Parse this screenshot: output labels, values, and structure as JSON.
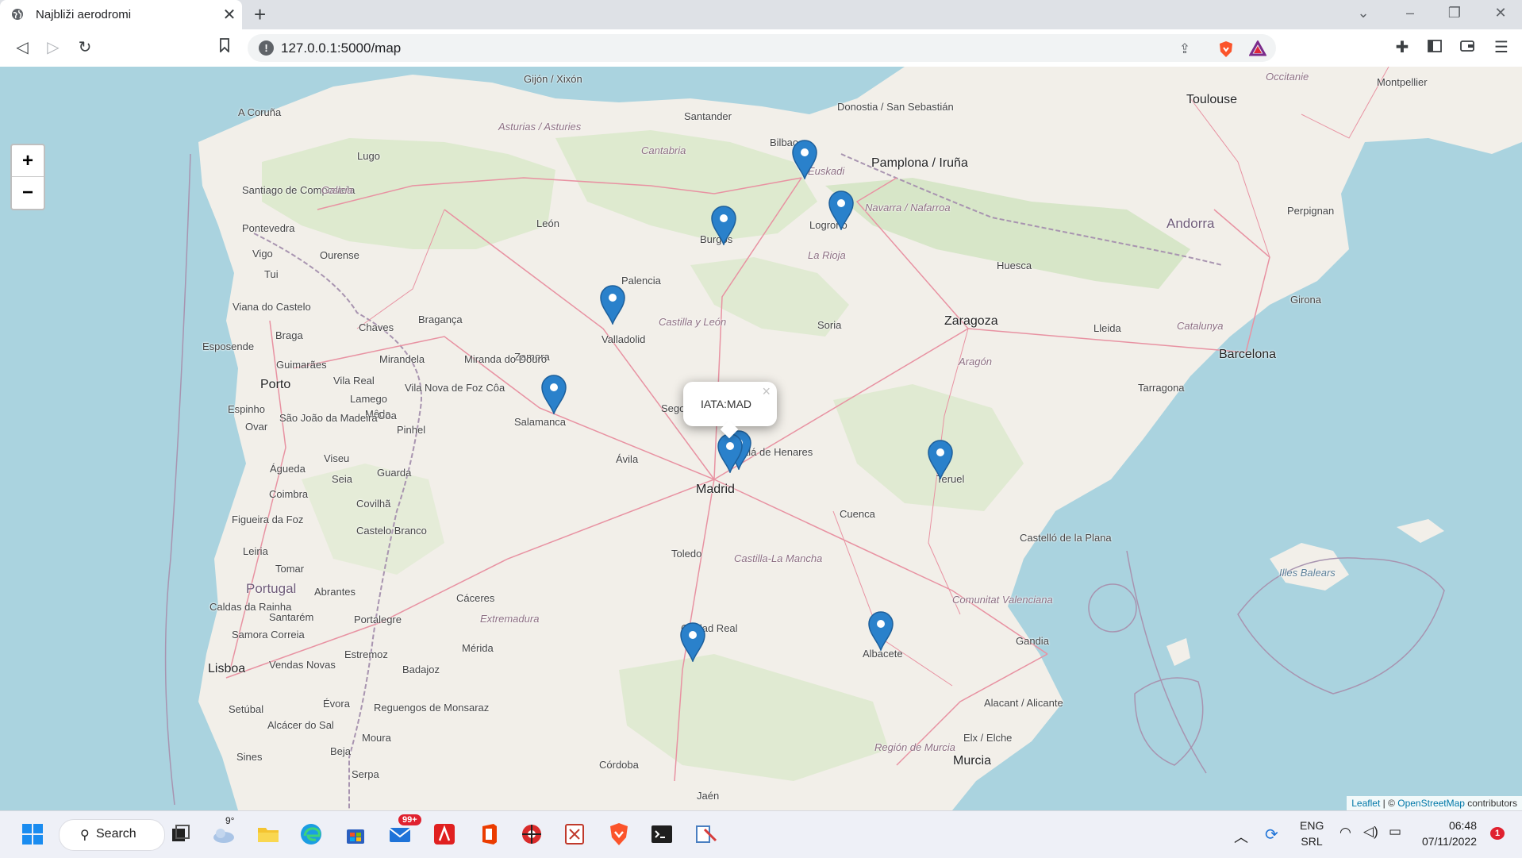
{
  "browser": {
    "tab_title": "Najbliži aerodromi",
    "url": "127.0.0.1:5000/map",
    "tab_close": "✕",
    "new_tab": "+"
  },
  "map": {
    "zoom_in": "+",
    "zoom_out": "−",
    "popup_text": "IATA:MAD",
    "popup_close": "×",
    "attribution_leaflet": "Leaflet",
    "attribution_sep": " | © ",
    "attribution_osm": "OpenStreetMap",
    "attribution_tail": " contributors",
    "labels": {
      "gijon": "Gijón / Xixón",
      "acoruna": "A Coruña",
      "lugo": "Lugo",
      "santiago": "Santiago de Compostela",
      "galicia": "Galicia",
      "pontevedra": "Pontevedra",
      "vigo": "Vigo",
      "ourense": "Ourense",
      "tui": "Tui",
      "viana": "Viana do Castelo",
      "braga": "Braga",
      "esposende": "Esposende",
      "guimaraes": "Guimarães",
      "porto": "Porto",
      "chaves": "Chaves",
      "mirandela": "Mirandela",
      "braganca": "Bragança",
      "asturias": "Asturias / Asturies",
      "cantabria": "Cantabria",
      "santander": "Santander",
      "bilbao": "Bilbao",
      "euskadi": "Euskadi",
      "donostia": "Donostia / San Sebastián",
      "pamplona": "Pamplona / Iruña",
      "navarra": "Navarra / Nafarroa",
      "logrono": "Logroño",
      "larioja": "La Rioja",
      "burgos": "Burgos",
      "leon": "León",
      "palencia": "Palencia",
      "castillaleon": "Castilla y León",
      "valladolid": "Valladolid",
      "zamora": "Zamora",
      "mirandadouro": "Miranda do Douro",
      "salamanca": "Salamanca",
      "segovia": "Segovia",
      "avila": "Ávila",
      "madrid": "Madrid",
      "alcala": "Alcalá de Henares",
      "soria": "Soria",
      "zaragoza": "Zaragoza",
      "huesca": "Huesca",
      "aragon": "Aragón",
      "lleida": "Lleida",
      "catalunya": "Catalunya",
      "barcelona": "Barcelona",
      "girona": "Girona",
      "tarragona": "Tarragona",
      "andorra": "Andorra",
      "perpignan": "Perpignan",
      "toulouse": "Toulouse",
      "occitanie": "Occitanie",
      "montpellier": "Montpellier",
      "teruel": "Teruel",
      "cuenca": "Cuenca",
      "toledo": "Toledo",
      "castillalamancha": "Castilla-La Mancha",
      "castellon": "Castelló de la Plana",
      "comunitat": "Comunitat Valenciana",
      "illes": "Illes Balears",
      "albacete": "Albacete",
      "ciudadreal": "Ciudad Real",
      "caceres": "Cáceres",
      "extremadura": "Extremadura",
      "merida": "Mérida",
      "badajoz": "Badajoz",
      "portugal": "Portugal",
      "lisboa": "Lisboa",
      "setubal": "Setúbal",
      "evora": "Évora",
      "beja": "Beja",
      "serpa": "Serpa",
      "sines": "Sines",
      "alcacer": "Alcácer do Sal",
      "coimbra": "Coimbra",
      "aveiro": "Águeda",
      "viseu": "Viseu",
      "guarda": "Guarda",
      "covilha": "Covilhã",
      "castelobranco": "Castelo Branco",
      "leiria": "Leiria",
      "tomar": "Tomar",
      "abrantes": "Abrantes",
      "santarem": "Santarém",
      "portalegre": "Portalegre",
      "estremoz": "Estremoz",
      "gandia": "Gandia",
      "alicante": "Alacant / Alicante",
      "elx": "Elx / Elche",
      "murcia": "Murcia",
      "regionmurcia": "Región de Murcia",
      "cordoba": "Córdoba",
      "jaen": "Jaén",
      "figueira": "Figueira da Foz",
      "caldas": "Caldas da Rainha",
      "samora": "Samora Correia",
      "vendas": "Vendas Novas",
      "reguengos": "Reguengos de Monsaraz",
      "moura": "Moura",
      "seia": "Seia",
      "lamego": "Lamego",
      "vilareal": "Vila Real",
      "meda": "Mêda",
      "pinhel": "Pinhel",
      "ovar": "Ovar",
      "espinho": "Espinho",
      "saojoao": "São João da Madeira",
      "foz": "Vila Nova de Foz Côa",
      "coa": "Coa"
    }
  },
  "taskbar": {
    "search_label": "Search",
    "weather_temp": "9°",
    "mail_badge": "99+",
    "lang_top": "ENG",
    "lang_bottom": "SRL",
    "time": "06:48",
    "date": "07/11/2022",
    "notif_count": "1"
  }
}
